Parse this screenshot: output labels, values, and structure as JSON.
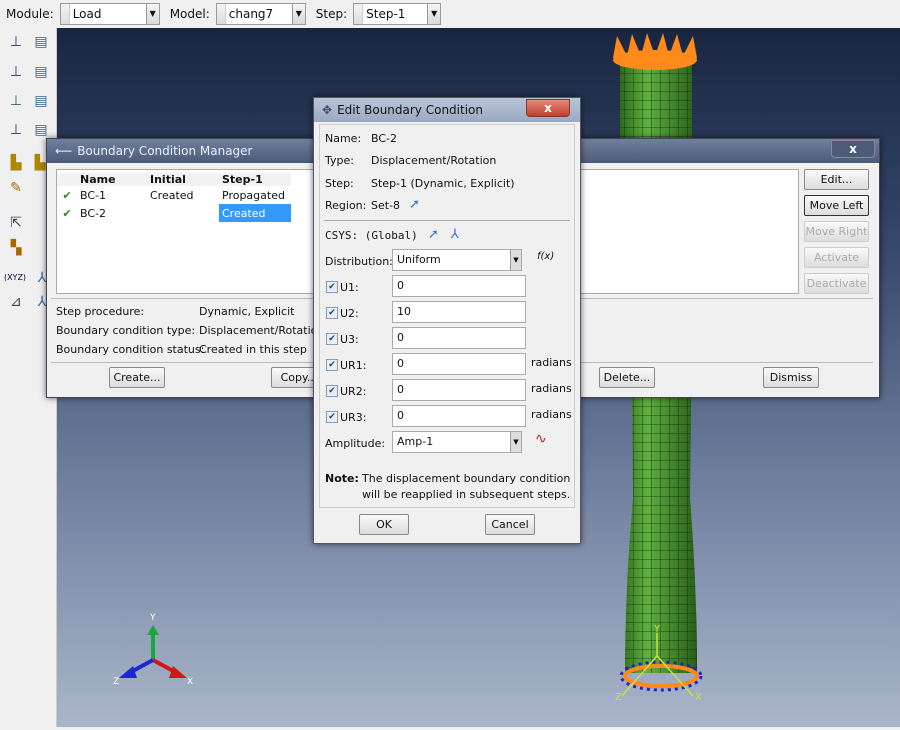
{
  "toolbar": {
    "module_label": "Module:",
    "module_value": "Load",
    "model_label": "Model:",
    "model_value": "chang7",
    "step_label": "Step:",
    "step_value": "Step-1"
  },
  "left_toolbar": {
    "xyz_label": "(XYZ)"
  },
  "viewport": {
    "triad": {
      "y": "Y",
      "x": "X",
      "z": "Z"
    },
    "model_csys": {
      "y": "Y",
      "x": "X",
      "z": "Z"
    }
  },
  "manager": {
    "title": "Boundary Condition Manager",
    "close": "x",
    "columns": [
      "Name",
      "Initial",
      "Step-1"
    ],
    "rows": [
      {
        "name": "BC-1",
        "initial": "Created",
        "step1": "Propagated"
      },
      {
        "name": "BC-2",
        "initial": "",
        "step1": "Created"
      }
    ],
    "info": {
      "procedure_label": "Step procedure:",
      "procedure_value": "Dynamic, Explicit",
      "type_label": "Boundary condition type:",
      "type_value": "Displacement/Rotation",
      "status_label": "Boundary condition status:",
      "status_value": "Created in this step"
    },
    "buttons": {
      "edit": "Edit...",
      "move_left": "Move Left",
      "move_right": "Move Right",
      "activate": "Activate",
      "deactivate": "Deactivate",
      "create": "Create...",
      "copy": "Copy...",
      "delete": "Delete...",
      "dismiss": "Dismiss"
    }
  },
  "edit": {
    "title": "Edit Boundary Condition",
    "close": "x",
    "name_label": "Name:",
    "name_value": "BC-2",
    "type_label": "Type:",
    "type_value": "Displacement/Rotation",
    "step_label": "Step:",
    "step_value": "Step-1 (Dynamic, Explicit)",
    "region_label": "Region:",
    "region_value": "Set-8",
    "csys_label": "CSYS:",
    "csys_value": "(Global)",
    "distribution_label": "Distribution:",
    "distribution_value": "Uniform",
    "fx": "f(x)",
    "dofs": [
      {
        "label": "U1:",
        "value": "0",
        "unit": ""
      },
      {
        "label": "U2:",
        "value": "10",
        "unit": ""
      },
      {
        "label": "U3:",
        "value": "0",
        "unit": ""
      },
      {
        "label": "UR1:",
        "value": "0",
        "unit": "radians"
      },
      {
        "label": "UR2:",
        "value": "0",
        "unit": "radians"
      },
      {
        "label": "UR3:",
        "value": "0",
        "unit": "radians"
      }
    ],
    "amplitude_label": "Amplitude:",
    "amplitude_value": "Amp-1",
    "note_label": "Note:",
    "note_line1": "The displacement boundary condition",
    "note_line2": "will be reapplied in subsequent steps.",
    "ok": "OK",
    "cancel": "Cancel"
  }
}
